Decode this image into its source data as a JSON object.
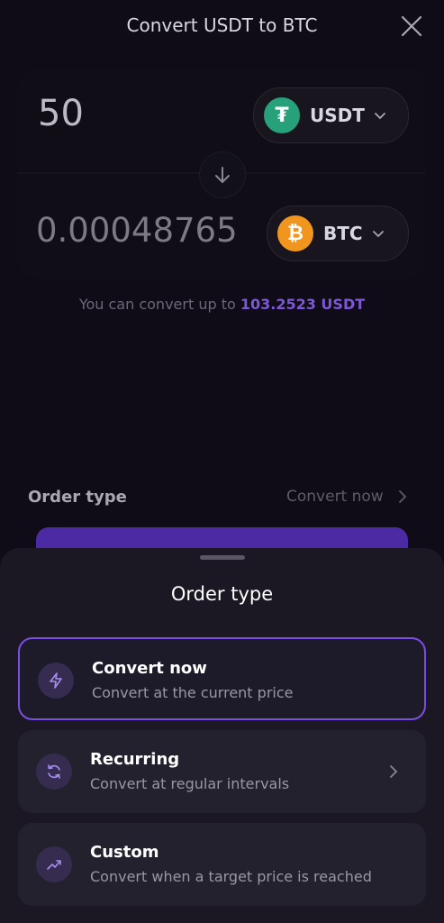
{
  "header": {
    "title": "Convert USDT to BTC"
  },
  "from": {
    "amount": "50",
    "token": "USDT"
  },
  "to": {
    "amount": "0.00048765",
    "token": "BTC"
  },
  "limit": {
    "prefix": "You can convert up to ",
    "value": "103.2523 USDT"
  },
  "order_row": {
    "label": "Order type",
    "value": "Convert now"
  },
  "sheet": {
    "title": "Order type",
    "options": [
      {
        "title": "Convert now",
        "subtitle": "Convert at the current price",
        "icon": "lightning-icon",
        "selected": true
      },
      {
        "title": "Recurring",
        "subtitle": "Convert at regular intervals",
        "icon": "refresh-icon",
        "selected": false
      },
      {
        "title": "Custom",
        "subtitle": "Convert when a target price is reached",
        "icon": "trend-up-icon",
        "selected": false
      }
    ]
  },
  "colors": {
    "accent": "#7a4ee0",
    "usdt": "#27a17a",
    "btc": "#f0961e",
    "limit_value": "#7c57d6"
  }
}
